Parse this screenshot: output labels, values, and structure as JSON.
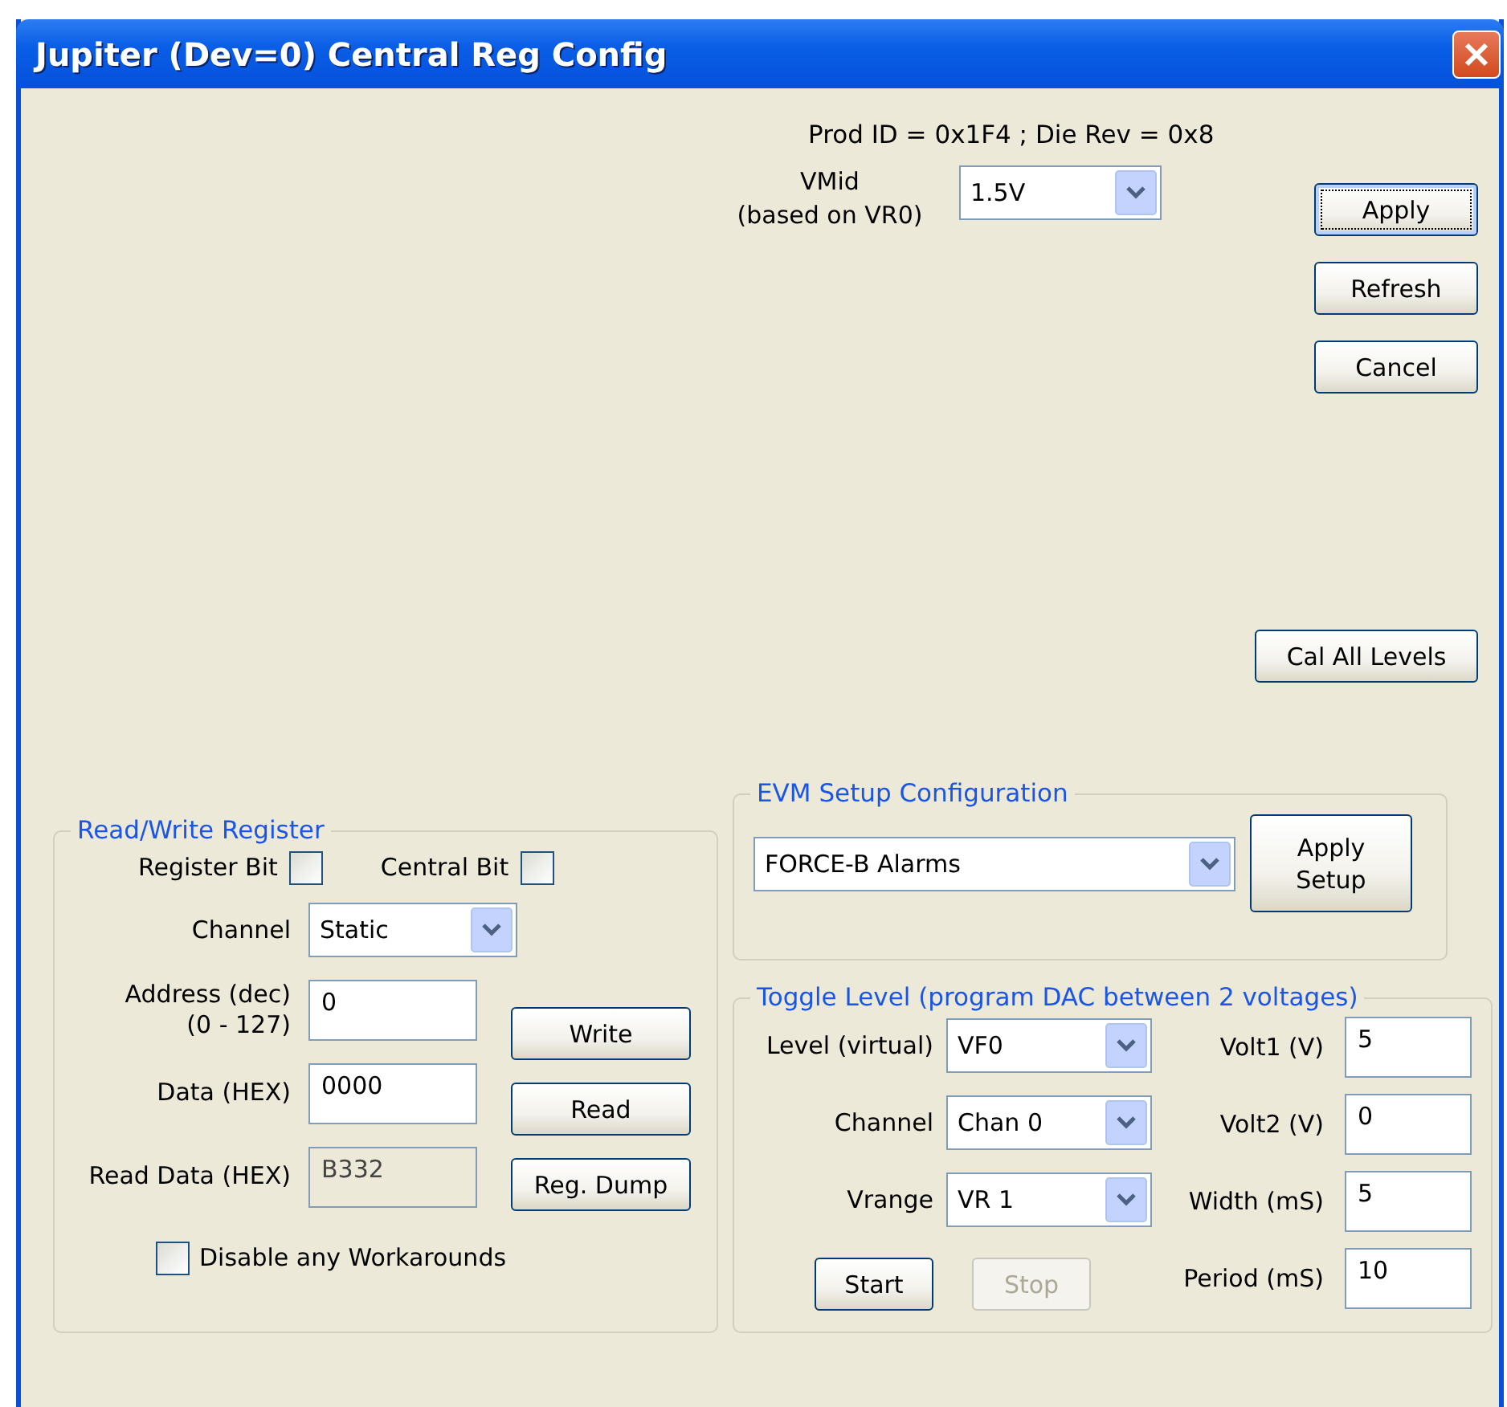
{
  "window": {
    "title": "Jupiter (Dev=0) Central Reg Config"
  },
  "header": {
    "info": "Prod ID = 0x1F4 ; Die Rev = 0x8",
    "vmid_label": [
      "VMid",
      "(based on VR0)"
    ],
    "vmid_value": "1.5V"
  },
  "buttons": [
    {
      "label": "Apply",
      "focused": true
    },
    {
      "label": "Refresh",
      "focused": false
    },
    {
      "label": "Cancel",
      "focused": false
    }
  ],
  "cal_button": "Cal All Levels",
  "read_write": {
    "title": "Read/Write Register",
    "bits": [
      {
        "label": "Register Bit",
        "checked": false
      },
      {
        "label": "Central Bit",
        "checked": false
      }
    ],
    "fields": [
      {
        "kind": "dropdown",
        "label": [
          "Channel"
        ],
        "value": "Static"
      },
      {
        "kind": "input",
        "label": [
          "Address (dec)",
          "(0 - 127)"
        ],
        "value": "0",
        "disabled": false
      },
      {
        "kind": "input",
        "label": [
          "Data (HEX)"
        ],
        "value": "0000",
        "disabled": false
      },
      {
        "kind": "input",
        "label": [
          "Read Data (HEX)"
        ],
        "value": "B332",
        "disabled": true
      }
    ],
    "buttons": [
      "Write",
      "Read",
      "Reg. Dump"
    ],
    "workaround": {
      "label": "Disable any Workarounds",
      "checked": false
    }
  },
  "evm": {
    "title": "EVM Setup Configuration",
    "value": "FORCE-B Alarms",
    "button": "Apply Setup"
  },
  "toggle": {
    "title": "Toggle Level (program DAC between 2 voltages)",
    "selects": [
      {
        "label": "Level (virtual)",
        "value": "VF0"
      },
      {
        "label": "Channel",
        "value": "Chan 0"
      },
      {
        "label": "Vrange",
        "value": "VR 1"
      }
    ],
    "fields": [
      {
        "label": "Volt1 (V)",
        "value": "5"
      },
      {
        "label": "Volt2 (V)",
        "value": "0"
      },
      {
        "label": "Width (mS)",
        "value": "5"
      },
      {
        "label": "Period (mS)",
        "value": "10"
      }
    ],
    "buttons": [
      {
        "label": "Start",
        "disabled": false
      },
      {
        "label": "Stop",
        "disabled": true
      }
    ]
  }
}
